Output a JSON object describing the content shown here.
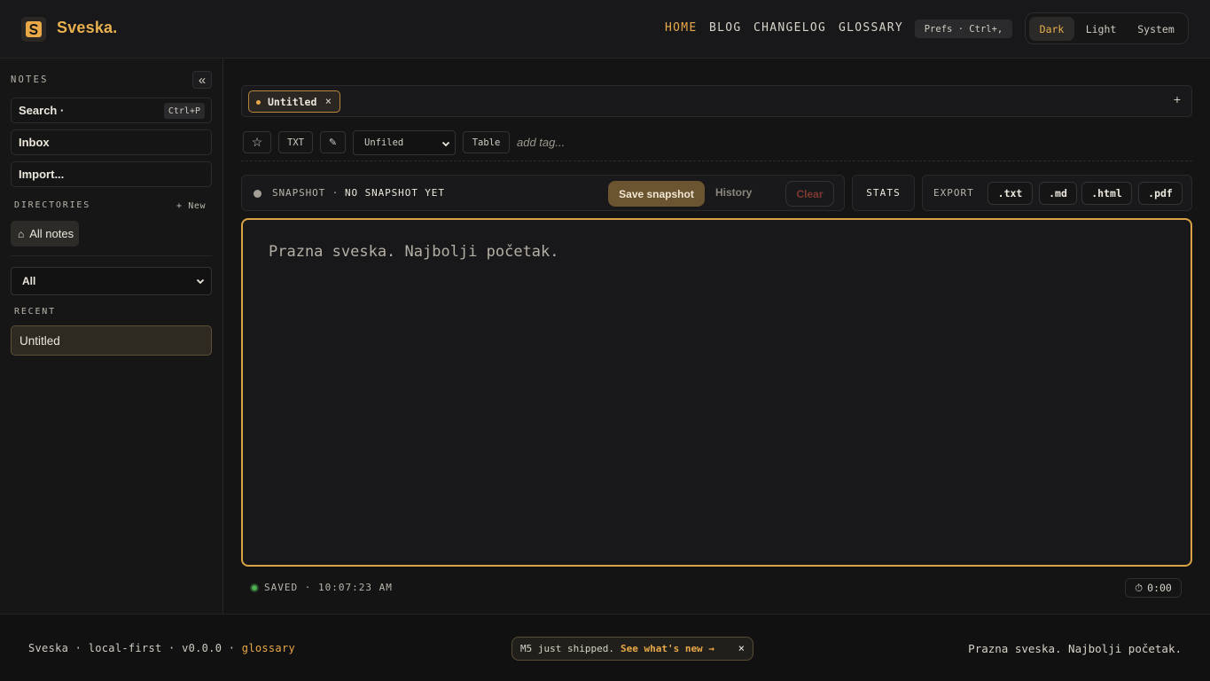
{
  "header": {
    "brand": "Sveska.",
    "nav": [
      {
        "label": "HOME",
        "active": true
      },
      {
        "label": "BLOG",
        "active": false
      },
      {
        "label": "CHANGELOG",
        "active": false
      },
      {
        "label": "GLOSSARY",
        "active": false
      }
    ],
    "prefs_label": "Prefs · Ctrl+,",
    "theme_options": [
      "Dark",
      "Light",
      "System"
    ],
    "theme_selected": "Dark"
  },
  "sidebar": {
    "notes_label": "NOTES",
    "collapse_icon": "«",
    "search_label": "Search ·",
    "search_shortcut": "Ctrl+P",
    "inbox_label": "Inbox",
    "import_label": "Import...",
    "directories_label": "DIRECTORIES",
    "new_dir_label": "+ New",
    "all_notes_label": "All notes",
    "filter_value": "All",
    "recent_label": "RECENT",
    "recent_items": [
      "Untitled"
    ]
  },
  "tabs": {
    "items": [
      {
        "label": "Untitled",
        "close": "×"
      }
    ],
    "add_icon": "+"
  },
  "toolbar": {
    "star_icon": "☆",
    "format_label": "TXT",
    "pen_icon": "✎",
    "folder_value": "Unfiled",
    "table_label": "Table",
    "tag_placeholder": "add tag..."
  },
  "snapshot": {
    "label": "SNAPSHOT ·",
    "status": "NO SNAPSHOT YET",
    "save_label": "Save snapshot",
    "history_label": "History",
    "clear_label": "Clear"
  },
  "stats_label": "STATS",
  "export": {
    "label": "EXPORT",
    "formats": [
      ".txt",
      ".md",
      ".html",
      ".pdf"
    ]
  },
  "editor": {
    "placeholder": "Prazna sveska. Najbolji početak."
  },
  "status": {
    "saved_text": "SAVED · 10:07:23 AM",
    "timer": "0:00"
  },
  "footer": {
    "left_text": "Sveska · local-first · v0.0.0 ·",
    "left_link": "glossary",
    "announcement": "M5 just shipped.",
    "announcement_link": "See what's new →",
    "announcement_close": "×",
    "right_text": "Prazna sveska. Najbolji početak."
  },
  "colors": {
    "accent": "#e9a948",
    "background": "#141415",
    "saved_green": "#4caf50"
  }
}
